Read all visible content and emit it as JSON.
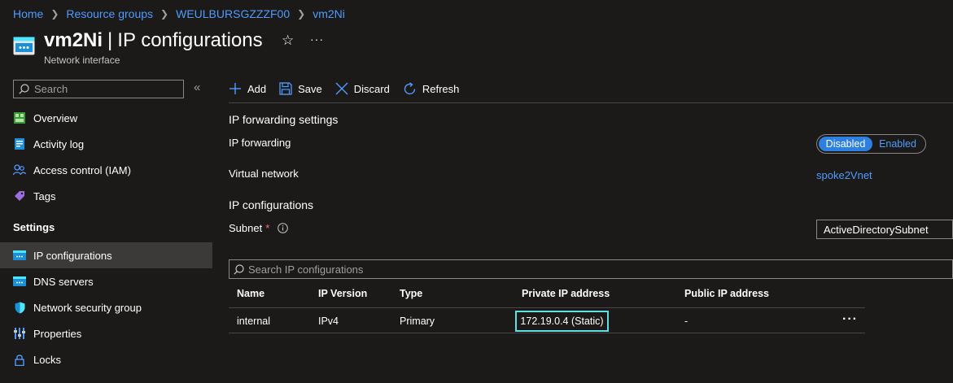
{
  "breadcrumb": [
    "Home",
    "Resource groups",
    "WEULBURSGZZZF00",
    "vm2Ni"
  ],
  "header": {
    "resource_name": "vm2Ni",
    "separator": "|",
    "page_name": "IP configurations",
    "subtitle": "Network interface",
    "star_icon": "star-icon",
    "more_label": "···"
  },
  "sidebar": {
    "search_placeholder": "Search",
    "collapse_label": "«",
    "items": [
      {
        "label": "Overview",
        "icon": "overview-icon"
      },
      {
        "label": "Activity log",
        "icon": "activity-log-icon"
      },
      {
        "label": "Access control (IAM)",
        "icon": "iam-icon"
      },
      {
        "label": "Tags",
        "icon": "tag-icon"
      }
    ],
    "section": "Settings",
    "settings_items": [
      {
        "label": "IP configurations",
        "icon": "ip-config-icon",
        "active": true
      },
      {
        "label": "DNS servers",
        "icon": "dns-icon"
      },
      {
        "label": "Network security group",
        "icon": "shield-icon"
      },
      {
        "label": "Properties",
        "icon": "properties-icon"
      },
      {
        "label": "Locks",
        "icon": "lock-icon"
      }
    ]
  },
  "toolbar": {
    "add": "Add",
    "save": "Save",
    "discard": "Discard",
    "refresh": "Refresh"
  },
  "content": {
    "ip_forwarding_settings_heading": "IP forwarding settings",
    "ip_forwarding_label": "IP forwarding",
    "toggle": {
      "disabled": "Disabled",
      "enabled": "Enabled",
      "selected": "Disabled"
    },
    "virtual_network_label": "Virtual network",
    "virtual_network_value": "spoke2Vnet",
    "ip_configurations_heading": "IP configurations",
    "subnet_label": "Subnet",
    "required_mark": "*",
    "info_icon": "info-icon",
    "subnet_value": "ActiveDirectorySubnet",
    "search_placeholder": "Search IP configurations"
  },
  "table": {
    "headers": [
      "Name",
      "IP Version",
      "Type",
      "Private IP address",
      "Public IP address"
    ],
    "rows": [
      {
        "name": "internal",
        "ip_version": "IPv4",
        "type": "Primary",
        "private_ip": "172.19.0.4 (Static)",
        "public_ip": "-",
        "more": "···"
      }
    ]
  },
  "colors": {
    "background": "#1b1a19",
    "link": "#4f9bff",
    "toggle_selected": "#2d7fe0",
    "highlight_border": "#5ce1e6",
    "active_nav": "#3b3a39"
  }
}
